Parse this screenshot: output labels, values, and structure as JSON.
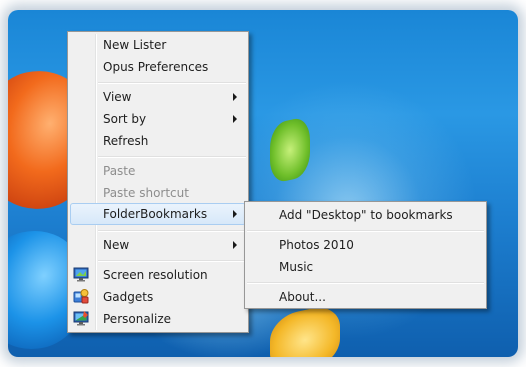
{
  "context_menu": {
    "items": [
      {
        "label": "New Lister"
      },
      {
        "label": "Opus Preferences"
      },
      {
        "label": "View"
      },
      {
        "label": "Sort by"
      },
      {
        "label": "Refresh"
      },
      {
        "label": "Paste"
      },
      {
        "label": "Paste shortcut"
      },
      {
        "label": "FolderBookmarks"
      },
      {
        "label": "New"
      },
      {
        "label": "Screen resolution",
        "icon": "screen-resolution-icon"
      },
      {
        "label": "Gadgets",
        "icon": "gadgets-icon"
      },
      {
        "label": "Personalize",
        "icon": "personalize-icon"
      }
    ]
  },
  "submenu": {
    "items": [
      {
        "label": "Add \"Desktop\" to bookmarks"
      },
      {
        "label": "Photos 2010"
      },
      {
        "label": "Music"
      },
      {
        "label": "About..."
      }
    ]
  },
  "colors": {
    "menu_background": "#f0f0f0",
    "highlight": "#d7e8f9",
    "disabled_text": "#8d8d8d"
  }
}
